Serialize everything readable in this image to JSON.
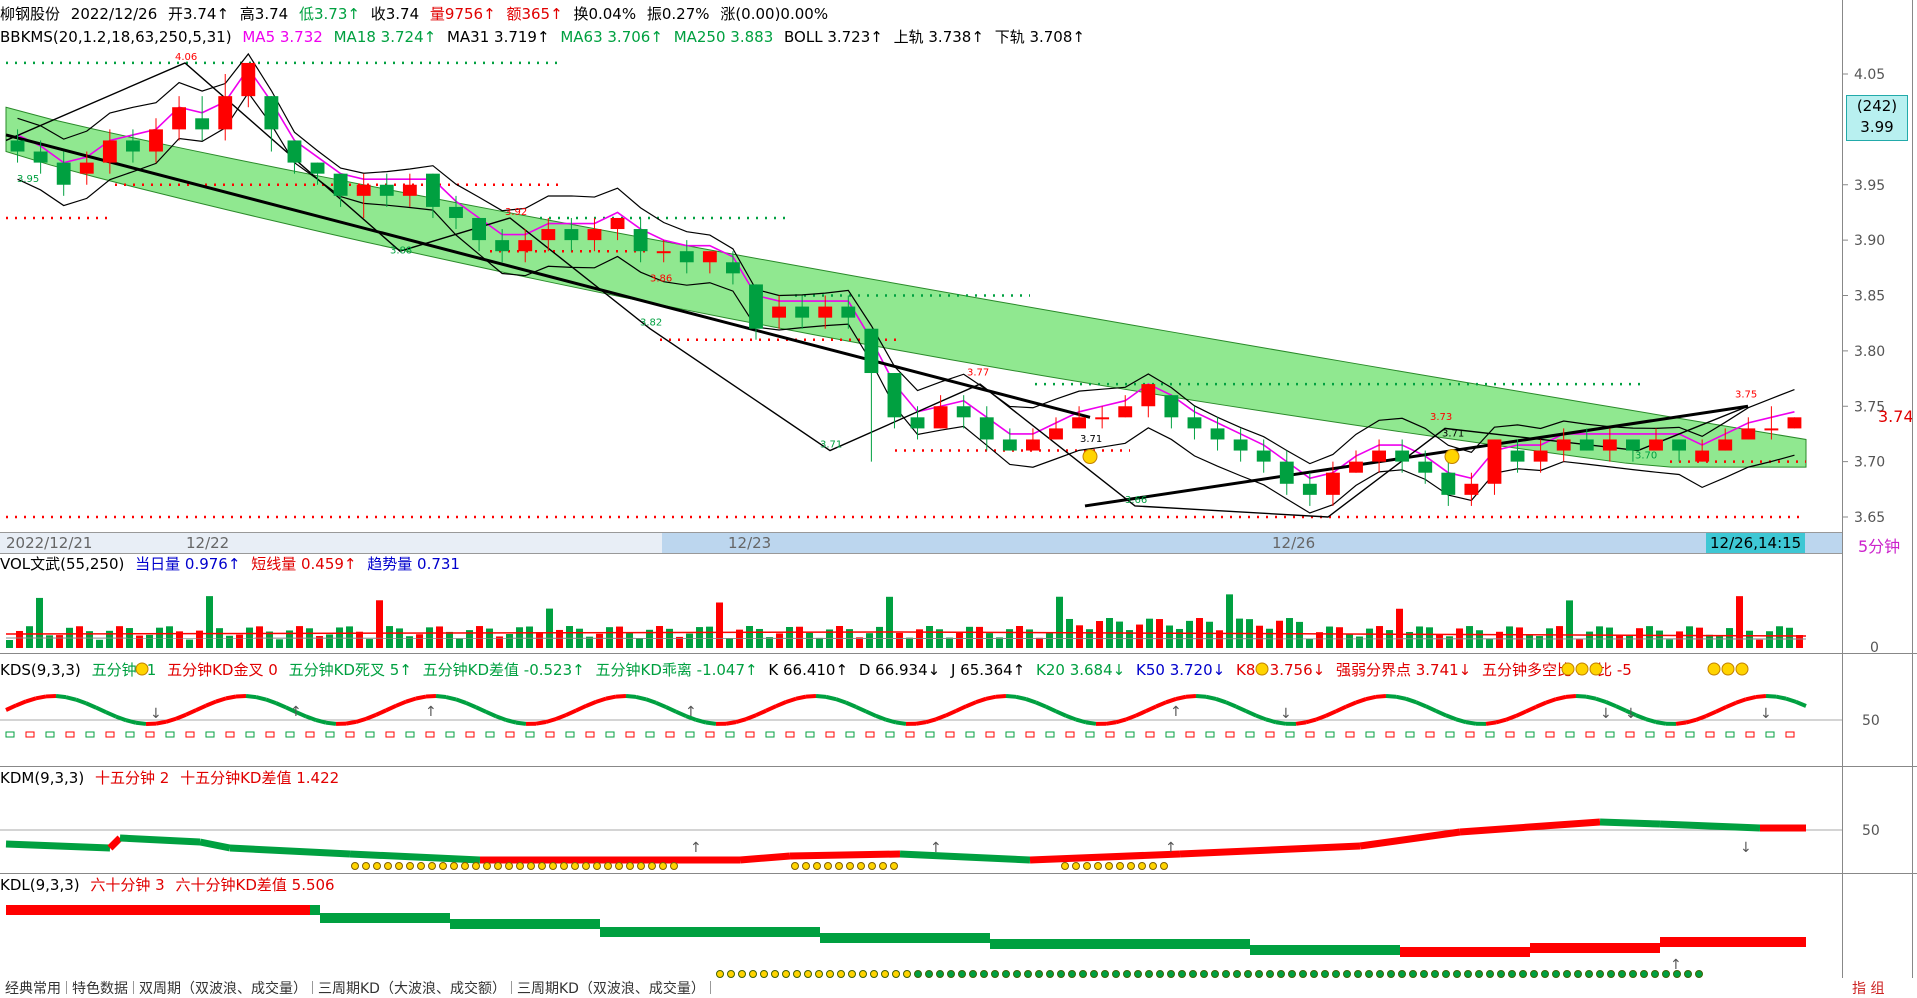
{
  "header": {
    "stock": "柳钢股份",
    "date": "2022/12/26",
    "open": "开3.74↑",
    "high": "高3.74",
    "low": "低3.73↑",
    "close": "收3.74",
    "volume": "量9756↑",
    "amount": "额365↑",
    "turnover": "换0.04%",
    "amplitude": "振0.27%",
    "change": "涨(0.00)0.00%"
  },
  "indicator": {
    "name": "BBKMS(20,1.2,18,63,250,5,31)",
    "ma5": "MA5 3.732",
    "ma18": "MA18 3.724↑",
    "ma31": "MA31 3.719↑",
    "ma63": "MA63 3.706↑",
    "ma250": "MA250 3.883",
    "boll": "BOLL 3.723↑",
    "upper": "上轨 3.738↑",
    "lower": "下轨 3.708↑"
  },
  "price_axis": [
    "4.05",
    "3.95",
    "3.90",
    "3.85",
    "3.80",
    "3.75",
    "3.70",
    "3.65"
  ],
  "price_box": {
    "count": "(242)",
    "price": "3.99"
  },
  "last_price": "3.74",
  "point_labels": [
    "4.06",
    "3.95",
    "3.88",
    "3.92",
    "3.86",
    "3.82",
    "3.71",
    "3.77",
    "3.71",
    "3.66",
    "3.73",
    "3.71",
    "3.70",
    "3.75"
  ],
  "time_axis": {
    "labels": [
      "2022/12/21",
      "12/22",
      "12/23",
      "12/26"
    ],
    "cursor": "12/26,14:15",
    "period": "5分钟"
  },
  "vol": {
    "title": "VOL文武(55,250)",
    "day": "当日量 0.976↑",
    "short": "短线量 0.459↑",
    "trend": "趋势量 0.731",
    "axis": "0"
  },
  "kds": {
    "title": "KDS(9,3,3)",
    "items": [
      "五分钟 -1",
      "五分钟KD金叉 0",
      "五分钟KD死叉 5↑",
      "五分钟KD差值 -0.523↑",
      "五分钟KD乖离 -1.047↑",
      "K 66.410↑",
      "D 66.934↓",
      "J 65.364↑",
      "K20 3.684↓",
      "K50 3.720↓",
      "K80 3.756↓",
      "强弱分界点 3.741↓",
      "五分钟多空比 5",
      "比 -5"
    ],
    "axis": "50"
  },
  "kdm": {
    "title": "KDM(9,3,3)",
    "items": [
      "十五分钟 2",
      "十五分钟KD差值 1.422"
    ],
    "axis": "50"
  },
  "kdl": {
    "title": "KDL(9,3,3)",
    "items": [
      "六十分钟 3",
      "六十分钟KD差值 5.506"
    ]
  },
  "tabs": [
    "经典常用",
    "特色数据",
    "双周期（双波浪、成交量）",
    "三周期KD（大波浪、成交额）",
    "三周期KD（双波浪、成交量）"
  ],
  "corner_tab": "指 组",
  "colors": {
    "up": "#ff0000",
    "down": "#00a040",
    "band": "#90e890",
    "ma5": "#ee00ee"
  },
  "chart_data": {
    "type": "candlestick",
    "title": "",
    "ylim": [
      3.64,
      4.08
    ],
    "y_ticks": [
      4.05,
      3.95,
      3.9,
      3.85,
      3.8,
      3.75,
      3.7,
      3.65
    ],
    "candles": [
      [
        3.99,
        3.98,
        4.0,
        3.97
      ],
      [
        3.98,
        3.97,
        3.99,
        3.96
      ],
      [
        3.97,
        3.95,
        3.98,
        3.94
      ],
      [
        3.96,
        3.97,
        3.98,
        3.95
      ],
      [
        3.97,
        3.99,
        4.0,
        3.96
      ],
      [
        3.99,
        3.98,
        4.0,
        3.97
      ],
      [
        3.98,
        4.0,
        4.01,
        3.97
      ],
      [
        4.0,
        4.02,
        4.03,
        3.99
      ],
      [
        4.01,
        4.0,
        4.03,
        3.99
      ],
      [
        4.0,
        4.03,
        4.05,
        3.99
      ],
      [
        4.03,
        4.06,
        4.06,
        4.02
      ],
      [
        4.03,
        4.0,
        4.03,
        3.98
      ],
      [
        3.99,
        3.97,
        3.99,
        3.96
      ],
      [
        3.97,
        3.96,
        3.97,
        3.95
      ],
      [
        3.96,
        3.94,
        3.96,
        3.93
      ],
      [
        3.94,
        3.95,
        3.96,
        3.92
      ],
      [
        3.95,
        3.94,
        3.96,
        3.93
      ],
      [
        3.94,
        3.95,
        3.96,
        3.93
      ],
      [
        3.96,
        3.93,
        3.96,
        3.92
      ],
      [
        3.93,
        3.92,
        3.94,
        3.91
      ],
      [
        3.92,
        3.9,
        3.92,
        3.89
      ],
      [
        3.9,
        3.89,
        3.91,
        3.88
      ],
      [
        3.89,
        3.9,
        3.91,
        3.88
      ],
      [
        3.9,
        3.91,
        3.92,
        3.89
      ],
      [
        3.91,
        3.9,
        3.92,
        3.89
      ],
      [
        3.9,
        3.91,
        3.92,
        3.89
      ],
      [
        3.91,
        3.92,
        3.92,
        3.9
      ],
      [
        3.91,
        3.89,
        3.92,
        3.88
      ],
      [
        3.89,
        3.89,
        3.9,
        3.88
      ],
      [
        3.89,
        3.88,
        3.9,
        3.87
      ],
      [
        3.88,
        3.89,
        3.89,
        3.87
      ],
      [
        3.88,
        3.87,
        3.89,
        3.86
      ],
      [
        3.86,
        3.82,
        3.86,
        3.81
      ],
      [
        3.83,
        3.84,
        3.85,
        3.82
      ],
      [
        3.84,
        3.83,
        3.85,
        3.82
      ],
      [
        3.83,
        3.84,
        3.85,
        3.82
      ],
      [
        3.84,
        3.83,
        3.85,
        3.82
      ],
      [
        3.82,
        3.78,
        3.82,
        3.7
      ],
      [
        3.78,
        3.74,
        3.78,
        3.73
      ],
      [
        3.74,
        3.73,
        3.75,
        3.72
      ],
      [
        3.73,
        3.75,
        3.76,
        3.73
      ],
      [
        3.75,
        3.74,
        3.76,
        3.73
      ],
      [
        3.74,
        3.72,
        3.75,
        3.71
      ],
      [
        3.72,
        3.71,
        3.73,
        3.71
      ],
      [
        3.71,
        3.72,
        3.73,
        3.71
      ],
      [
        3.72,
        3.73,
        3.74,
        3.72
      ],
      [
        3.73,
        3.74,
        3.75,
        3.73
      ],
      [
        3.74,
        3.74,
        3.75,
        3.73
      ],
      [
        3.74,
        3.75,
        3.76,
        3.74
      ],
      [
        3.75,
        3.77,
        3.77,
        3.74
      ],
      [
        3.76,
        3.74,
        3.76,
        3.73
      ],
      [
        3.74,
        3.73,
        3.75,
        3.72
      ],
      [
        3.73,
        3.72,
        3.74,
        3.71
      ],
      [
        3.72,
        3.71,
        3.73,
        3.7
      ],
      [
        3.71,
        3.7,
        3.72,
        3.69
      ],
      [
        3.7,
        3.68,
        3.71,
        3.67
      ],
      [
        3.68,
        3.67,
        3.69,
        3.66
      ],
      [
        3.67,
        3.69,
        3.7,
        3.66
      ],
      [
        3.69,
        3.7,
        3.71,
        3.69
      ],
      [
        3.7,
        3.71,
        3.72,
        3.69
      ],
      [
        3.71,
        3.7,
        3.72,
        3.69
      ],
      [
        3.7,
        3.69,
        3.71,
        3.68
      ],
      [
        3.69,
        3.67,
        3.7,
        3.66
      ],
      [
        3.67,
        3.68,
        3.69,
        3.66
      ],
      [
        3.68,
        3.72,
        3.72,
        3.67
      ],
      [
        3.71,
        3.7,
        3.72,
        3.69
      ],
      [
        3.7,
        3.71,
        3.72,
        3.69
      ],
      [
        3.71,
        3.72,
        3.73,
        3.7
      ],
      [
        3.72,
        3.71,
        3.73,
        3.71
      ],
      [
        3.71,
        3.72,
        3.73,
        3.7
      ],
      [
        3.72,
        3.71,
        3.72,
        3.7
      ],
      [
        3.71,
        3.72,
        3.73,
        3.71
      ],
      [
        3.72,
        3.71,
        3.72,
        3.7
      ],
      [
        3.7,
        3.71,
        3.72,
        3.7
      ],
      [
        3.71,
        3.72,
        3.73,
        3.71
      ],
      [
        3.72,
        3.73,
        3.74,
        3.72
      ],
      [
        3.73,
        3.73,
        3.75,
        3.72
      ],
      [
        3.73,
        3.74,
        3.74,
        3.73
      ]
    ]
  }
}
